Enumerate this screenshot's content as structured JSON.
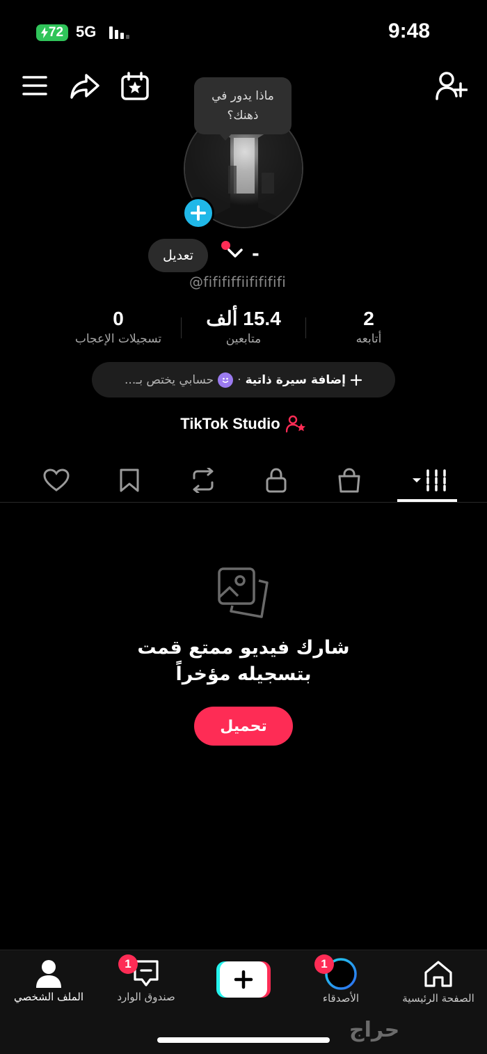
{
  "status_bar": {
    "battery": "72",
    "network": "5G",
    "time": "9:48"
  },
  "top_bar": {
    "icons": [
      "menu-icon",
      "share-icon",
      "calendar-star-icon",
      "add-friend-icon"
    ]
  },
  "tooltip": {
    "line1": "ماذا يدور في",
    "line2": "ذهنك؟"
  },
  "profile": {
    "edit_label": "تعديل",
    "name": "-",
    "username": "@fifififfiififififi"
  },
  "stats": {
    "following": {
      "value": "2",
      "label": "أتابعه"
    },
    "followers": {
      "value": "15.4 ألف",
      "label": "متابعين"
    },
    "likes": {
      "value": "0",
      "label": "تسجيلات الإعجاب"
    }
  },
  "bio": {
    "add_label": "إضافة سيرة ذاتية",
    "separator": "·",
    "hint": "حسابي يختص بـ..."
  },
  "studio": {
    "label": "TikTok Studio"
  },
  "tabs": [
    "videos-grid",
    "shop",
    "private",
    "reposts",
    "favorites",
    "liked"
  ],
  "empty_state": {
    "line1": "شارك فيديو ممتع قمت",
    "line2": "بتسجيله مؤخراً",
    "upload_label": "تحميل"
  },
  "bottom_nav": {
    "home": "الصفحة الرئيسية",
    "friends": "الأصدقاء",
    "friends_badge": "1",
    "inbox": "صندوق الوارد",
    "inbox_badge": "1",
    "profile": "الملف الشخصي"
  },
  "watermark": "حراج",
  "colors": {
    "accent": "#fe2c55",
    "avatar_plus": "#20b8e8",
    "battery": "#30c45a"
  }
}
